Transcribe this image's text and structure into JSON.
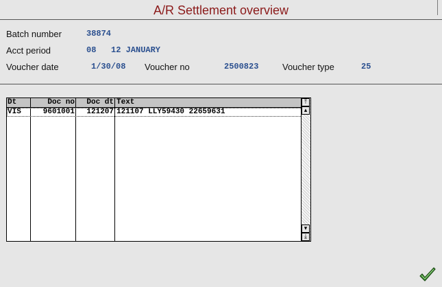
{
  "window": {
    "title": "A/R Settlement overview"
  },
  "fields": {
    "batch_number": {
      "label": "Batch number",
      "value": "38874"
    },
    "acct_period": {
      "label": "Acct period",
      "value": "08",
      "value2": "12 JANUARY"
    },
    "voucher_date": {
      "label": "Voucher date",
      "value": "1/30/08"
    },
    "voucher_no": {
      "label": "Voucher no",
      "value": "2500823"
    },
    "voucher_type": {
      "label": "Voucher type",
      "value": "25"
    }
  },
  "table": {
    "columns": [
      "Dt",
      "Doc no",
      "Doc dt",
      "Text"
    ],
    "rows": [
      {
        "dt": "VIS",
        "doc_no": "9601001",
        "doc_dt": "121207",
        "text": "121107 LLY59430 22659631"
      }
    ]
  },
  "icons": {
    "scroll_top": "scroll-to-top-icon",
    "scroll_up": "scroll-up-icon",
    "scroll_down": "scroll-down-icon",
    "scroll_bottom": "scroll-to-bottom-icon",
    "confirm": "checkmark-icon"
  },
  "colors": {
    "title": "#8b1a1a",
    "value": "#2a4f8f",
    "confirm": "#3a8a2e"
  }
}
